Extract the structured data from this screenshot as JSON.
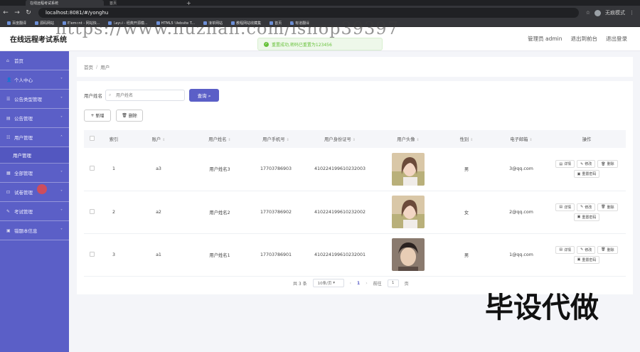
{
  "browser": {
    "tab_active": "在线远程考试系统",
    "tab_second": "首页",
    "url": "localhost:8081/#/yonghu",
    "guest_label": "无痕模式",
    "bookmarks": [
      "百度翻译",
      "源码网站",
      "Element - 网站快...",
      "Layui - 经典开源模...",
      "HTML5 Website T...",
      "接单网站",
      "教程网站收藏集",
      "首页",
      "有道翻译"
    ]
  },
  "watermark": "https://www.huzhan.com/ishop39397",
  "stamp": "毕设代做",
  "header": {
    "title": "在线远程考试系统",
    "user": "管理员 admin",
    "to_front": "退出到前台",
    "logout": "退出登录"
  },
  "toast": {
    "text": "重置成功,密码已重置为123456"
  },
  "sidebar": {
    "items": [
      {
        "label": "首页",
        "icon": "home-icon"
      },
      {
        "label": "个人中心",
        "icon": "user-icon",
        "has_children": true
      },
      {
        "label": "公告类型管理",
        "icon": "list-icon",
        "has_children": true
      },
      {
        "label": "公告管理",
        "icon": "notice-icon",
        "has_children": true
      },
      {
        "label": "用户管理",
        "icon": "users-icon",
        "has_children": true,
        "expanded": true
      },
      {
        "label": "全部管理",
        "icon": "grid-icon",
        "has_children": true
      },
      {
        "label": "试卷管理",
        "icon": "paper-icon",
        "has_children": true
      },
      {
        "label": "考试管理",
        "icon": "exam-icon",
        "has_children": true
      },
      {
        "label": "错题本信息",
        "icon": "book-icon",
        "has_children": true
      }
    ],
    "submenu": "用户管理"
  },
  "breadcrumb": {
    "home": "首页",
    "current": "用户"
  },
  "search": {
    "label": "用户姓名",
    "placeholder": "用户姓名",
    "button": "查询"
  },
  "actions": {
    "add": "新增",
    "delete": "删除"
  },
  "table": {
    "headers": [
      "索引",
      "账户",
      "用户姓名",
      "用户手机号",
      "用户身份证号",
      "用户头像",
      "性别",
      "电子邮箱",
      "操作"
    ],
    "rows": [
      {
        "index": "1",
        "account": "a3",
        "name": "用户姓名3",
        "phone": "17703786903",
        "idcard": "410224199610232003",
        "gender": "男",
        "email": "3@qq.com"
      },
      {
        "index": "2",
        "account": "a2",
        "name": "用户姓名2",
        "phone": "17703786902",
        "idcard": "410224199610232002",
        "gender": "女",
        "email": "2@qq.com"
      },
      {
        "index": "3",
        "account": "a1",
        "name": "用户姓名1",
        "phone": "17703786901",
        "idcard": "410224199610232001",
        "gender": "男",
        "email": "1@qq.com"
      }
    ],
    "ops": {
      "detail": "详情",
      "edit": "修改",
      "delete": "删除",
      "reset": "重置密码"
    }
  },
  "pager": {
    "total": "共 3 条",
    "size": "10条/页",
    "current": "1",
    "goto": "前往",
    "goto_value": "1",
    "page_suffix": "页"
  }
}
